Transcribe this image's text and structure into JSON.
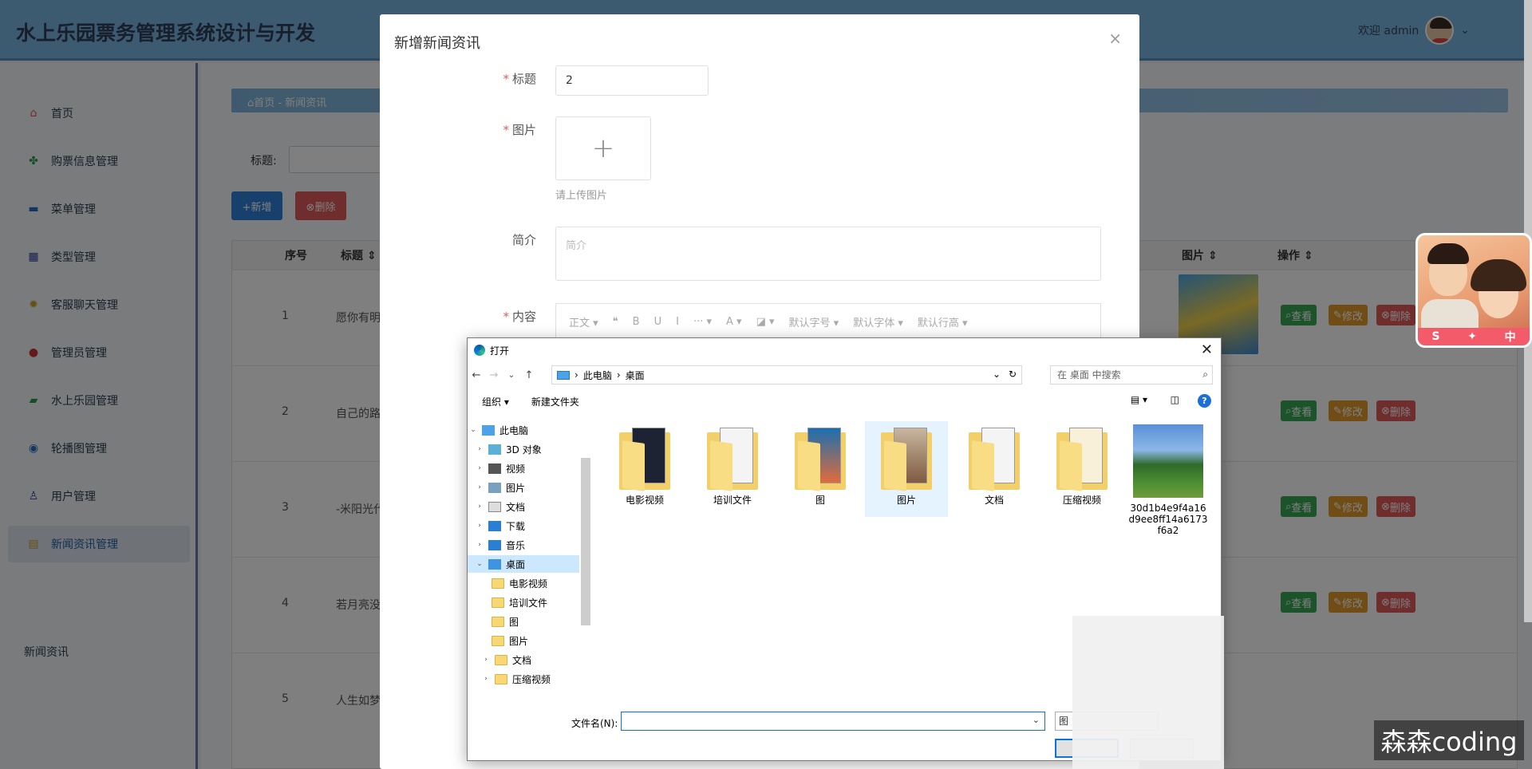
{
  "app": {
    "title": "水上乐园票务管理系统设计与开发",
    "welcome": "欢迎 admin"
  },
  "sidebar": {
    "items": [
      {
        "label": "首页",
        "icon": "home-icon"
      },
      {
        "label": "购票信息管理",
        "icon": "clover-icon"
      },
      {
        "label": "菜单管理",
        "icon": "menu-icon"
      },
      {
        "label": "类型管理",
        "icon": "grid-icon"
      },
      {
        "label": "客服聊天管理",
        "icon": "gear-icon"
      },
      {
        "label": "管理员管理",
        "icon": "person-icon"
      },
      {
        "label": "水上乐园管理",
        "icon": "park-icon"
      },
      {
        "label": "轮播图管理",
        "icon": "carousel-icon"
      },
      {
        "label": "用户管理",
        "icon": "user-icon"
      },
      {
        "label": "新闻资讯管理",
        "icon": "news-icon"
      }
    ],
    "sub_item": "新闻资讯"
  },
  "main": {
    "breadcrumb": "⌂首页 - 新闻资讯",
    "search_label": "标题:",
    "add_button": "+新增",
    "delete_button": "⊗删除",
    "columns": {
      "index": "序号",
      "title": "标题 ⇕",
      "image": "图片 ⇕",
      "actions": "操作 ⇕"
    },
    "rows": [
      {
        "index": "1",
        "title": "愿你有明"
      },
      {
        "index": "2",
        "title": "自己的路"
      },
      {
        "index": "3",
        "title": "-米阳光代"
      },
      {
        "index": "4",
        "title": "若月亮没"
      },
      {
        "index": "5",
        "title": "人生如梦"
      }
    ],
    "view_label": "查看",
    "edit_label": "修改",
    "del_label": "删除"
  },
  "modal": {
    "title": "新增新闻资讯",
    "fields": {
      "title_label": "标题",
      "title_value": "2",
      "image_label": "图片",
      "image_tip": "请上传图片",
      "intro_label": "简介",
      "intro_placeholder": "简介",
      "content_label": "内容"
    },
    "editor_tools": [
      "正文 ▾",
      "❝",
      "B",
      "U",
      "I",
      "··· ▾",
      "A ▾",
      "◪ ▾",
      "默认字号 ▾",
      "默认字体 ▾",
      "默认行高 ▾"
    ]
  },
  "file_dialog": {
    "title": "打开",
    "path": [
      "此电脑",
      "桌面"
    ],
    "search_placeholder": "在 桌面 中搜索",
    "toolbar": {
      "organize": "组织 ▾",
      "new_folder": "新建文件夹"
    },
    "tree": [
      {
        "label": "此电脑",
        "level": 0,
        "expanded": true
      },
      {
        "label": "3D 对象",
        "level": 1
      },
      {
        "label": "视频",
        "level": 1
      },
      {
        "label": "图片",
        "level": 1
      },
      {
        "label": "文档",
        "level": 1
      },
      {
        "label": "下载",
        "level": 1
      },
      {
        "label": "音乐",
        "level": 1
      },
      {
        "label": "桌面",
        "level": 1,
        "expanded": true,
        "selected": true
      },
      {
        "label": "电影视频",
        "level": 2
      },
      {
        "label": "培训文件",
        "level": 2
      },
      {
        "label": "图",
        "level": 2
      },
      {
        "label": "图片",
        "level": 2
      },
      {
        "label": "文档",
        "level": 2
      },
      {
        "label": "压缩视频",
        "level": 2
      }
    ],
    "files": [
      {
        "name": "电影视频",
        "kind": "folder"
      },
      {
        "name": "培训文件",
        "kind": "folder"
      },
      {
        "name": "图",
        "kind": "folder"
      },
      {
        "name": "图片",
        "kind": "folder",
        "selected": true
      },
      {
        "name": "文档",
        "kind": "folder"
      },
      {
        "name": "压缩视频",
        "kind": "folder"
      },
      {
        "name": "30d1b4e9f4a16d9ee8ff14a6173f6a2",
        "kind": "image"
      }
    ],
    "filename_label": "文件名(N):",
    "filename_value": "",
    "type_label": "图"
  },
  "watermark": "森森coding"
}
